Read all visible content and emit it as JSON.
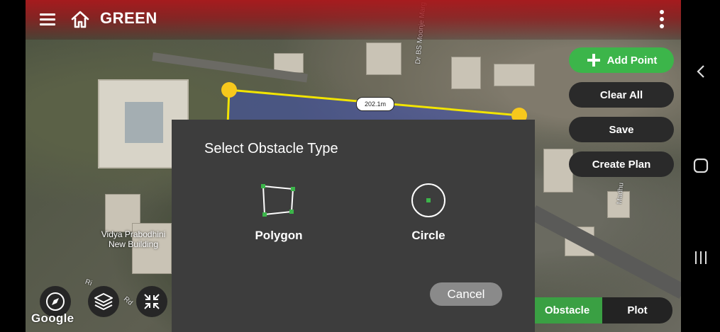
{
  "app": {
    "title": "GREEN"
  },
  "map": {
    "place_label_line1": "Vidya Prabodhini",
    "place_label_line2": "New Building",
    "road_label_1": "Dr BS Moonje Marg",
    "road_label_2": "Madhu",
    "road_label_3": "Ri",
    "road_label_4": "Rd",
    "distance": "202.1m",
    "attribution": "Google"
  },
  "side_buttons": {
    "add_point": "Add Point",
    "clear_all": "Clear All",
    "save": "Save",
    "create_plan": "Create Plan"
  },
  "dialog": {
    "title": "Select Obstacle Type",
    "option_polygon": "Polygon",
    "option_circle": "Circle",
    "cancel": "Cancel"
  },
  "tabs": {
    "obstacle": "Obstacle",
    "plot": "Plot",
    "active": "Obstacle"
  },
  "icons": {
    "menu": "hamburger-menu-icon",
    "home": "home-icon",
    "more": "more-vertical-icon",
    "compass": "compass-icon",
    "layers": "layers-icon",
    "collapse": "collapse-arrows-icon",
    "add": "plus-icon"
  },
  "colors": {
    "topbar": "#aa181c",
    "accent_green": "#3cb54a",
    "polygon_stroke": "#f2e400",
    "vertex": "#f7c81c",
    "polygon_fill": "#3d4fb0",
    "dialog_bg": "#3d3d3d",
    "shape_icon_green": "#3cb54a"
  }
}
